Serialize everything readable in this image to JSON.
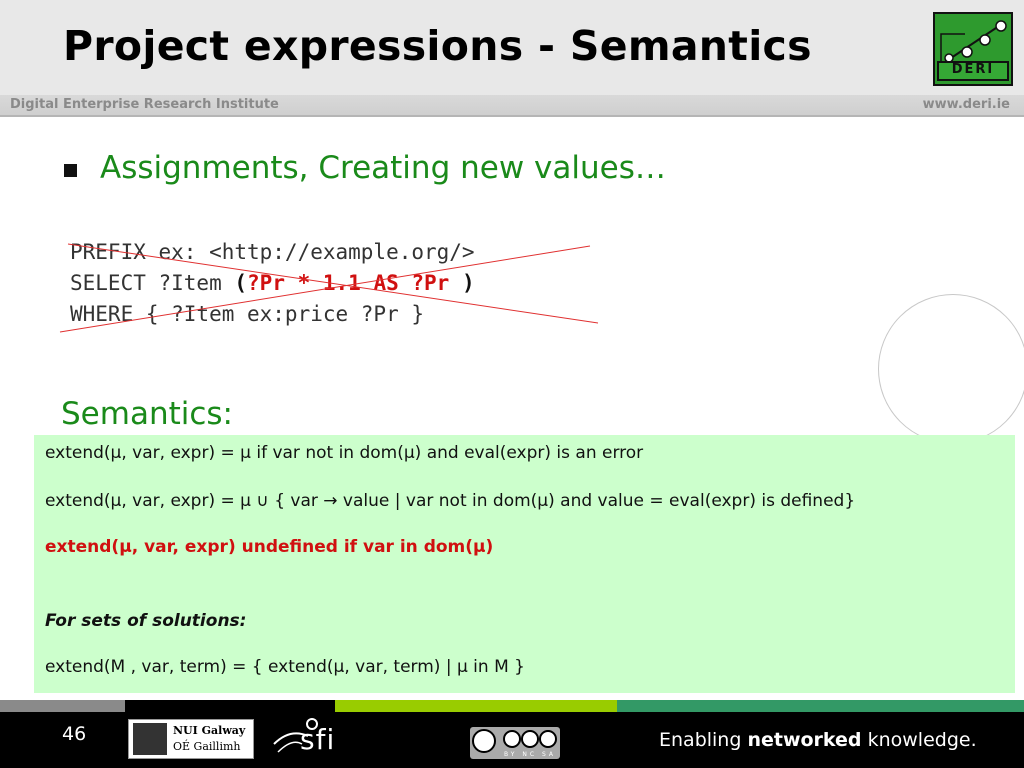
{
  "slide": {
    "title": "Project expressions - Semantics",
    "subheader_left": "Digital Enterprise Research Institute",
    "subheader_right": "www.deri.ie",
    "logo_text": "DERI",
    "bullet": "Assignments, Creating new values…",
    "code": {
      "line1": "PREFIX ex: <http://example.org/>",
      "line2_prefix": "SELECT ?Item ",
      "line2_open": "(",
      "line2_expr": "?Pr * 1.1 AS ?Pr",
      "line2_close": " )",
      "line3": "WHERE { ?Item ex:price ?Pr }"
    },
    "semantics_heading": "Semantics:",
    "box": {
      "line1": "extend(μ, var, expr) = μ if var not in dom(μ) and eval(expr) is an error",
      "line2": "extend(μ, var, expr) = μ ∪ { var → value | var not in dom(μ) and value = eval(expr) is defined}",
      "line3": "extend(μ, var, expr) undefined if var in dom(μ)",
      "line4": "For sets of solutions:",
      "line5": "extend(M , var, term) = { extend(μ, var, term) | μ in M }"
    },
    "page_number": "46",
    "footer": {
      "nui_line1": "NUI Galway",
      "nui_line2": "OÉ Gaillimh",
      "sfi_text": "sfi",
      "cc_label": "BY NC SA",
      "tagline_pre": "Enabling ",
      "tagline_bold": "networked",
      "tagline_post": " knowledge."
    },
    "colors": {
      "green_text": "#1a8a1a",
      "red_text": "#d01010",
      "box_bg": "#ccffcc",
      "bar_gray": "#8a8a8a",
      "bar_black": "#000000",
      "bar_lime": "#99cc00",
      "bar_teal": "#339966"
    }
  }
}
